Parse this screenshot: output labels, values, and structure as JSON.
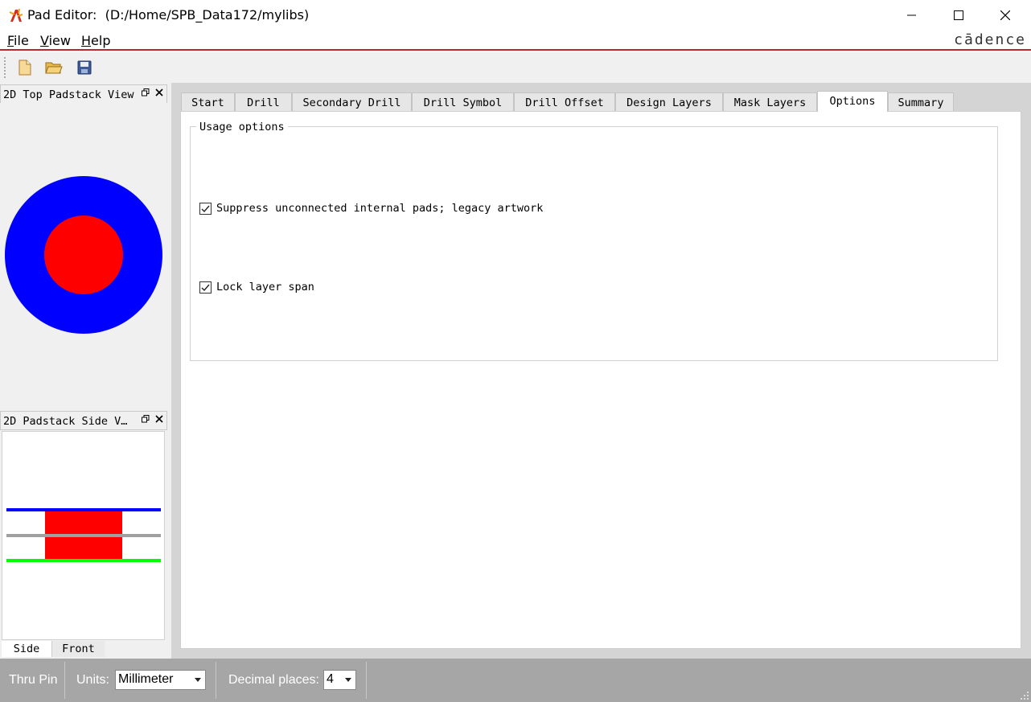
{
  "window": {
    "title": "Pad Editor:  (D:/Home/SPB_Data172/mylibs)",
    "brand": "cādence"
  },
  "menu": {
    "items": [
      {
        "label_u": "F",
        "label_rest": "ile"
      },
      {
        "label_u": "V",
        "label_rest": "iew"
      },
      {
        "label_u": "H",
        "label_rest": "elp"
      }
    ]
  },
  "toolbar": {
    "icons": [
      "new-file-icon",
      "open-folder-icon",
      "save-icon"
    ]
  },
  "left_panels": {
    "top_view_title": "2D Top Padstack View",
    "side_view_title": "2D Padstack Side V…",
    "side_tabs": [
      "Side",
      "Front"
    ],
    "active_side_tab": "Side"
  },
  "tabs": [
    "Start",
    "Drill",
    "Secondary Drill",
    "Drill Symbol",
    "Drill Offset",
    "Design Layers",
    "Mask Layers",
    "Options",
    "Summary"
  ],
  "active_tab": "Options",
  "options": {
    "group_title": "Usage options",
    "suppress_label": "Suppress unconnected internal pads; legacy artwork",
    "suppress_checked": true,
    "lock_label": "Lock layer span",
    "lock_checked": true
  },
  "status": {
    "mode": "Thru Pin",
    "units_label": "Units:",
    "units_value": "Millimeter",
    "decimal_label": "Decimal places:",
    "decimal_value": "4"
  },
  "colors": {
    "accent_red": "#c8202c",
    "pad_outer": "#0000ff",
    "pad_drill": "#ff0000",
    "layer_top": "#0000ff",
    "layer_inner": "#a0a0a0",
    "layer_bottom": "#00ff00"
  }
}
